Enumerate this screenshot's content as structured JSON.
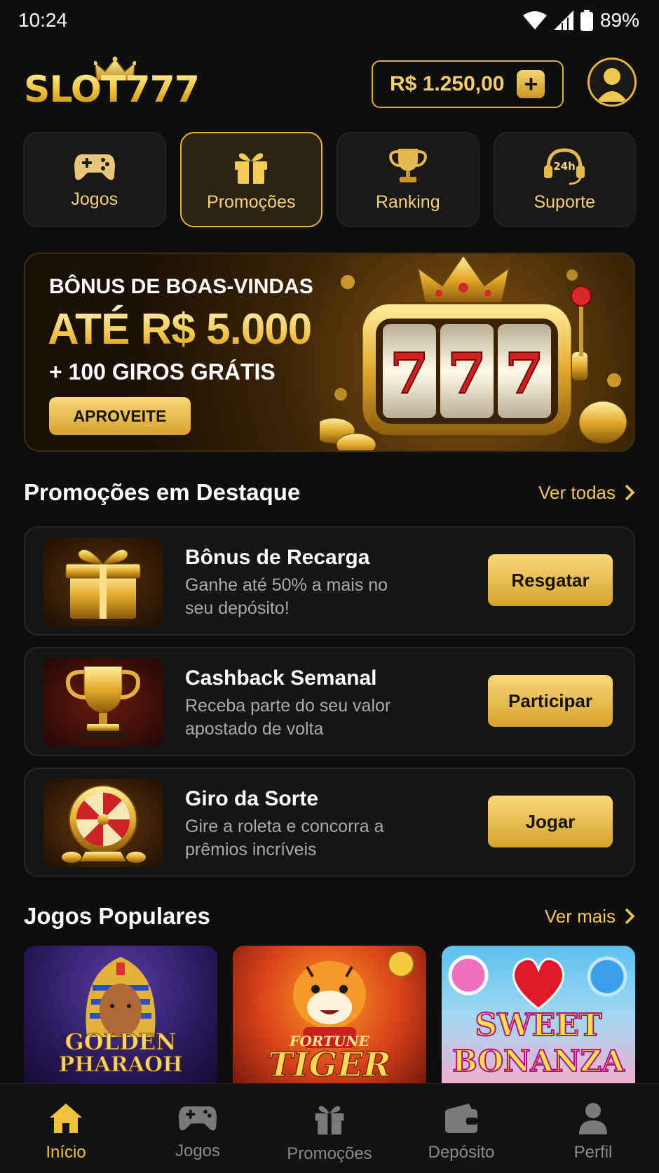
{
  "status_bar": {
    "time": "10:24",
    "battery": "89%"
  },
  "header": {
    "logo_text": "SLOT777",
    "balance": "R$ 1.250,00",
    "add_symbol": "+"
  },
  "categories": [
    {
      "label": "Jogos",
      "icon": "gamepad-icon",
      "active": false
    },
    {
      "label": "Promoções",
      "icon": "gift-icon",
      "active": true
    },
    {
      "label": "Ranking",
      "icon": "trophy-icon",
      "active": false
    },
    {
      "label": "Suporte",
      "icon": "headset-24h-icon",
      "active": false
    }
  ],
  "hero": {
    "subtitle": "BÔNUS DE BOAS-VINDAS",
    "headline": "ATÉ R$ 5.000",
    "extra": "+ 100 GIROS GRÁTIS",
    "cta": "APROVEITE",
    "reel_symbols": [
      "7",
      "7",
      "7"
    ]
  },
  "featured": {
    "title": "Promoções em Destaque",
    "link": "Ver todas",
    "items": [
      {
        "title": "Bônus de Recarga",
        "desc": "Ganhe até 50% a mais no seu depósito!",
        "button": "Resgatar",
        "image": "gift-box"
      },
      {
        "title": "Cashback Semanal",
        "desc": "Receba parte do seu valor apostado de volta",
        "button": "Participar",
        "image": "trophy"
      },
      {
        "title": "Giro da Sorte",
        "desc": "Gire a roleta e concorra a prêmios incríveis",
        "button": "Jogar",
        "image": "wheel"
      }
    ]
  },
  "popular": {
    "title": "Jogos Populares",
    "link": "Ver mais",
    "games": [
      {
        "name_line1": "GOLDEN",
        "name_line2": "PHARAOH"
      },
      {
        "name_line1": "FORTUNE",
        "name_line2": "TIGER"
      },
      {
        "name_line1": "SWEET",
        "name_line2": "BONANZA"
      }
    ]
  },
  "bottom_nav": [
    {
      "label": "Início",
      "icon": "home-icon",
      "active": true
    },
    {
      "label": "Jogos",
      "icon": "gamepad-icon",
      "active": false
    },
    {
      "label": "Promoções",
      "icon": "gift-icon",
      "active": false
    },
    {
      "label": "Depósito",
      "icon": "wallet-icon",
      "active": false
    },
    {
      "label": "Perfil",
      "icon": "person-icon",
      "active": false
    }
  ],
  "colors": {
    "accent": "#f0c240",
    "background": "#0e0e0e",
    "card": "#161616"
  }
}
